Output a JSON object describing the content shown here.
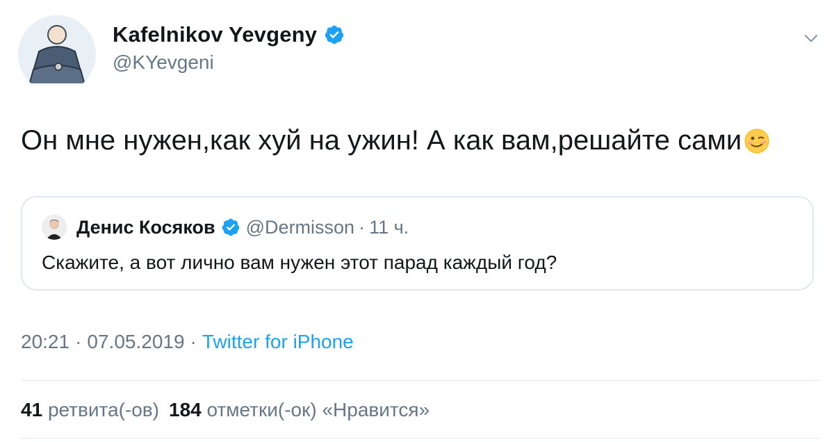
{
  "author": {
    "display_name": "Kafelnikov Yevgeny",
    "handle": "@KYevgeni",
    "verified": true,
    "avatar_icon": "profile-photo-icon"
  },
  "tweet": {
    "text": "Он мне нужен,как хуй на ужин! А как вам,решайте сами",
    "emoji": "winking-face-icon"
  },
  "quoted": {
    "display_name": "Денис Косяков",
    "handle": "@Dermisson",
    "dot": "·",
    "time": "11 ч.",
    "text": "Скажите, а вот лично вам нужен этот парад каждый год?"
  },
  "meta": {
    "time": "20:21",
    "sep1": "·",
    "date": "07.05.2019",
    "sep2": "·",
    "source": "Twitter for iPhone"
  },
  "stats": {
    "retweets": "41",
    "retweets_label": "ретвита(-ов)",
    "likes": "184",
    "likes_label": "отметки(-ок) «Нравится»"
  },
  "colors": {
    "verified": "#1da1f2",
    "link": "#1da1f2",
    "secondary_text": "#657786",
    "border": "#e1e8ed"
  }
}
